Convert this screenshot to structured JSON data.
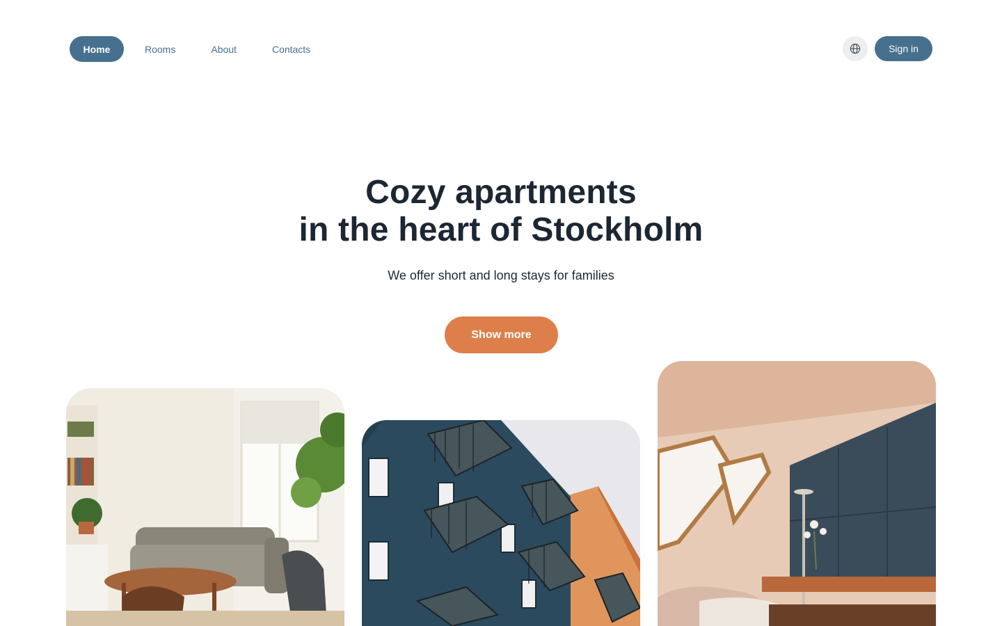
{
  "header": {
    "nav": {
      "home": "Home",
      "rooms": "Rooms",
      "about": "About",
      "contacts": "Contacts"
    },
    "language_icon": "globe-icon",
    "sign_in": "Sign in"
  },
  "hero": {
    "title_line1": "Cozy apartments",
    "title_line2": "in the heart of Stockholm",
    "subtitle": "We offer short and long stays for families",
    "cta": "Show more"
  },
  "gallery": {
    "photos": [
      "living-room-photo",
      "apartment-building-photo",
      "attic-bedroom-photo"
    ]
  },
  "colors": {
    "primary": "#46708e",
    "accent": "#de7f4b",
    "text": "#1c2733"
  }
}
